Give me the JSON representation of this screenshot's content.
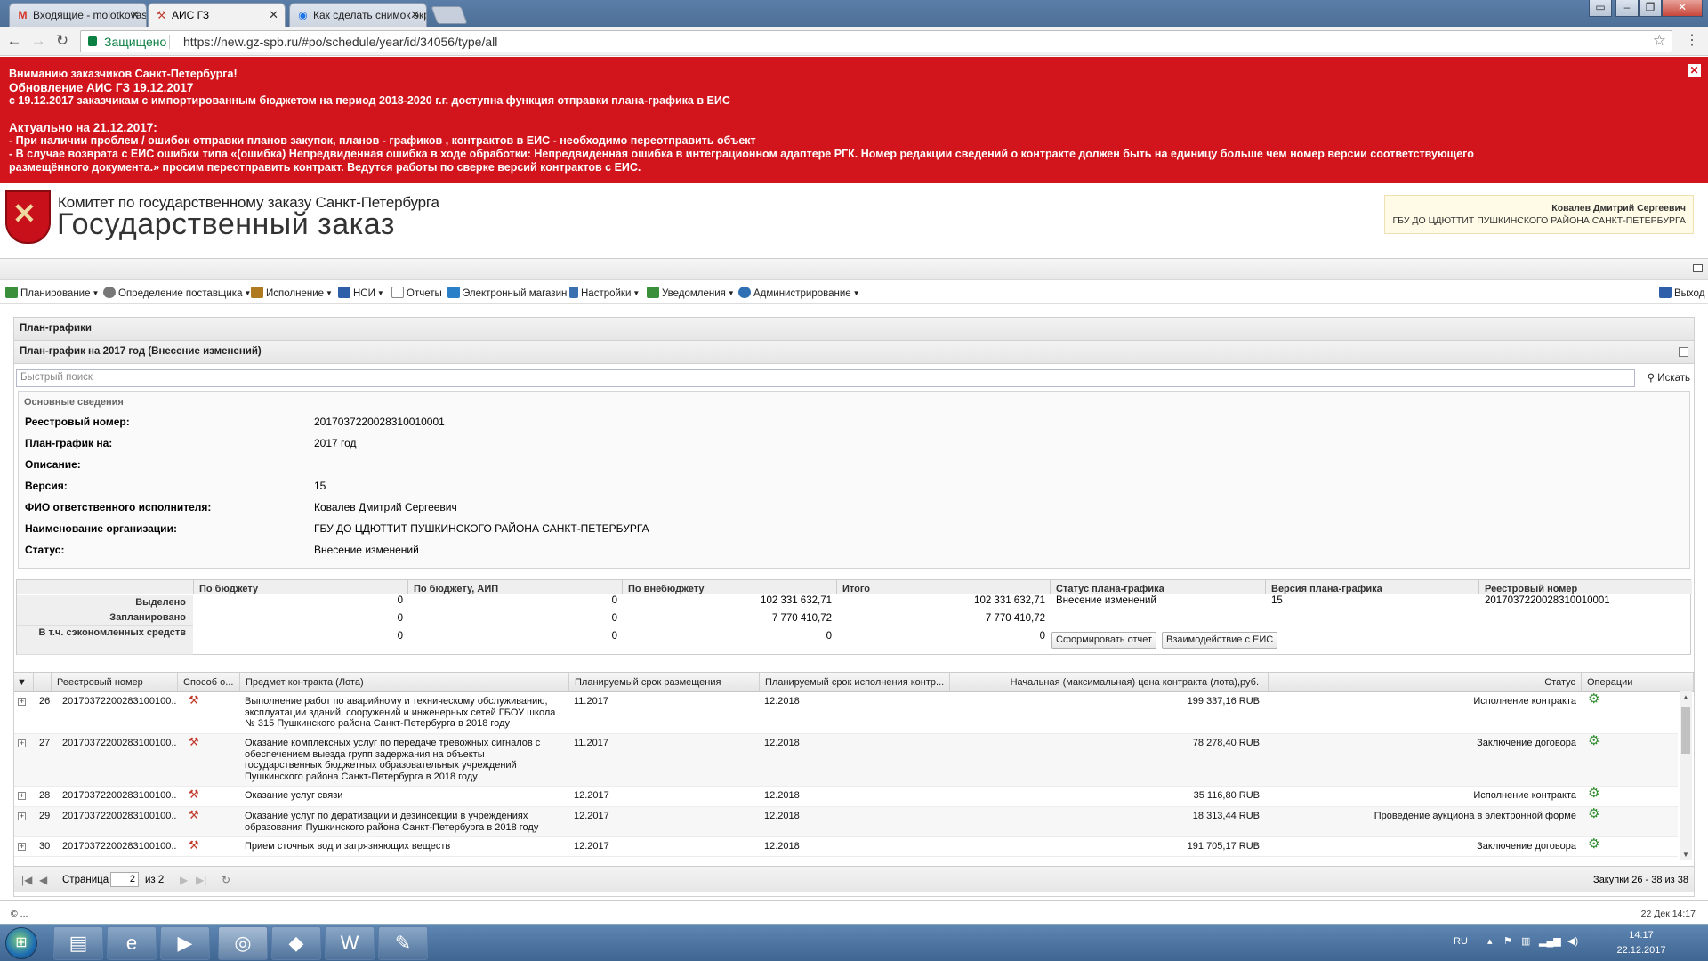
{
  "browser": {
    "tabs": [
      {
        "title": "Входящие - molotkovas",
        "icon": "gmail-icon"
      },
      {
        "title": "АИС ГЗ",
        "icon": "ais-icon"
      },
      {
        "title": "Как сделать снимок экр",
        "icon": "globe-icon"
      }
    ],
    "secure_label": "Защищено",
    "url": "https://new.gz-spb.ru/#po/schedule/year/id/34056/type/all"
  },
  "banner": {
    "line1": "Вниманию заказчиков Санкт-Петербурга!",
    "line2": "Обновление АИС ГЗ 19.12.2017",
    "line3": "с 19.12.2017 заказчикам с импортированным бюджетом на период 2018-2020 г.г.  доступна функция отправки плана-графика  в ЕИС",
    "line4": "Актуально на 21.12.2017:",
    "line5": "- При наличии проблем / ошибок отправки планов закупок, планов - графиков , контрактов в ЕИС - необходимо переотправить объект",
    "line6": "- В случае возврата с ЕИС ошибки типа «(ошибка) Непредвиденная ошибка в ходе обработки: Непредвиденная ошибка в интеграционном адаптере РГК. Номер редакции сведений о контракте должен быть на единицу больше чем номер версии соответствующего",
    "line7": "размещённого документа.» просим переотправить контракт. Ведутся работы по сверке версий контрактов с ЕИС."
  },
  "header": {
    "committee": "Комитет по государственному заказу Санкт-Петербурга",
    "title": "Государственный заказ",
    "user_name": "Ковалев Дмитрий Сергеевич",
    "user_org": "ГБУ ДО ЦДЮТТИТ ПУШКИНСКОГО РАЙОНА САНКТ-ПЕТЕРБУРГА"
  },
  "menu": {
    "items": [
      {
        "label": "Планирование",
        "icon": "planning-icon",
        "color": "#3a8f3a"
      },
      {
        "label": "Определение поставщика",
        "icon": "supplier-icon",
        "color": "#666666"
      },
      {
        "label": "Исполнение",
        "icon": "execution-icon",
        "color": "#b07a20"
      },
      {
        "label": "НСИ",
        "icon": "book-icon",
        "color": "#2f5fa8"
      },
      {
        "label": "Отчеты",
        "icon": "report-icon",
        "color": "#888888"
      },
      {
        "label": "Электронный магазин",
        "icon": "shop-icon",
        "color": "#2a7fc9"
      },
      {
        "label": "Настройки",
        "icon": "wrench-icon",
        "color": "#3a6fb0"
      },
      {
        "label": "Уведомления",
        "icon": "notify-icon",
        "color": "#3a8f3a"
      },
      {
        "label": "Администрирование",
        "icon": "admin-icon",
        "color": "#2f6fb3"
      }
    ],
    "logout": "Выход"
  },
  "content": {
    "panel_title": "План-графики",
    "subpanel_title": "План-график на 2017 год (Внесение изменений)",
    "search_placeholder": "Быстрый поиск",
    "search_button": "Искать"
  },
  "info": {
    "legend": "Основные сведения",
    "rows": [
      {
        "label": "Реестровый номер:",
        "value": "2017037220028310010001"
      },
      {
        "label": "План-график на:",
        "value": "2017 год"
      },
      {
        "label": "Описание:",
        "value": ""
      },
      {
        "label": "Версия:",
        "value": "15"
      },
      {
        "label": "ФИО ответственного исполнителя:",
        "value": "Ковалев Дмитрий Сергеевич"
      },
      {
        "label": "Наименование организации:",
        "value": "ГБУ ДО ЦДЮТТИТ ПУШКИНСКОГО РАЙОНА САНКТ-ПЕТЕРБУРГА"
      },
      {
        "label": "Статус:",
        "value": "Внесение изменений"
      }
    ]
  },
  "summary": {
    "headers": [
      "По бюджету",
      "По бюджету, АИП",
      "По внебюджету",
      "Итого",
      "Статус плана-графика",
      "Версия плана-графика",
      "Реестровый номер"
    ],
    "rows": [
      {
        "label": "Выделено",
        "values": [
          "0",
          "0",
          "102 331 632,71",
          "102 331 632,71"
        ]
      },
      {
        "label": "Запланировано",
        "values": [
          "0",
          "0",
          "7 770 410,72",
          "7 770 410,72"
        ]
      },
      {
        "label": "В т.ч. сэкономленных средств",
        "values": [
          "0",
          "0",
          "0",
          "0"
        ]
      }
    ],
    "status": "Внесение изменений",
    "version": "15",
    "registry": "2017037220028310010001",
    "btn_report": "Сформировать отчет",
    "btn_eis": "Взаимодействие с ЕИС"
  },
  "grid": {
    "headers": [
      "Реестровый номер",
      "Способ о...",
      "Предмет контракта (Лота)",
      "Планируемый срок размещения",
      "Планируемый срок исполнения контр...",
      "Начальная (максимальная) цена контракта (лота),руб.",
      "Статус",
      "Операции"
    ],
    "rows": [
      {
        "n": "26",
        "reg": "20170372200283100100...",
        "subject": "Выполнение работ по аварийному и техническому обслуживанию, эксплуатации зданий, сооружений и инженерных сетей ГБОУ школа № 315 Пушкинского района Санкт-Петербурга в 2018 году",
        "place": "11.2017",
        "exec": "12.2018",
        "price": "199 337,16 RUB",
        "status": "Исполнение контракта"
      },
      {
        "n": "27",
        "reg": "20170372200283100100...",
        "subject": "Оказание комплексных услуг по передаче тревожных сигналов с обеспечением выезда групп задержания на объекты государственных бюджетных образовательных учреждений Пушкинского района Санкт-Петербурга в 2018 году",
        "place": "11.2017",
        "exec": "12.2018",
        "price": "78 278,40 RUB",
        "status": "Заключение договора"
      },
      {
        "n": "28",
        "reg": "20170372200283100100...",
        "subject": "Оказание услуг связи",
        "place": "12.2017",
        "exec": "12.2018",
        "price": "35 116,80 RUB",
        "status": "Исполнение контракта"
      },
      {
        "n": "29",
        "reg": "20170372200283100100...",
        "subject": "Оказание услуг по дератизации и дезинсекции в учреждениях образования Пушкинского района Санкт-Петербурга в 2018 году",
        "place": "12.2017",
        "exec": "12.2018",
        "price": "18 313,44 RUB",
        "status": "Проведение аукциона в электронной форме"
      },
      {
        "n": "30",
        "reg": "20170372200283100100...",
        "subject": "Прием сточных вод и загрязняющих веществ",
        "place": "12.2017",
        "exec": "12.2018",
        "price": "191 705,17 RUB",
        "status": "Заключение договора"
      }
    ]
  },
  "paging": {
    "page_label": "Страница",
    "page": "2",
    "of": "из 2",
    "summary": "Закупки 26 - 38 из 38"
  },
  "footer": {
    "left": "© ...",
    "right": "22 Дек 14:17"
  },
  "taskbar": {
    "lang": "RU",
    "time": "14:17",
    "date": "22.12.2017"
  }
}
